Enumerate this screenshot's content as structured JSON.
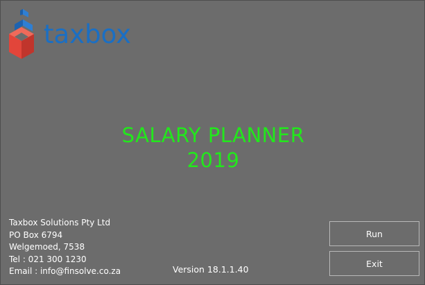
{
  "logo": {
    "text": "taxbox",
    "text_color": "#1a6fc4",
    "icon": "taxbox-cube-logo"
  },
  "title": {
    "line1": "SALARY PLANNER",
    "line2": "2019",
    "color": "#22e81c"
  },
  "company": {
    "name": "Taxbox Solutions Pty Ltd",
    "address1": "PO Box 6794",
    "address2": "Welgemoed, 7538",
    "tel": "Tel : 021 300 1230",
    "email": "Email : info@finsolve.co.za"
  },
  "version": "Version 18.1.1.40",
  "buttons": {
    "run": "Run",
    "exit": "Exit"
  },
  "colors": {
    "background": "#6c6c6c",
    "button_border": "#b9b9b9"
  }
}
